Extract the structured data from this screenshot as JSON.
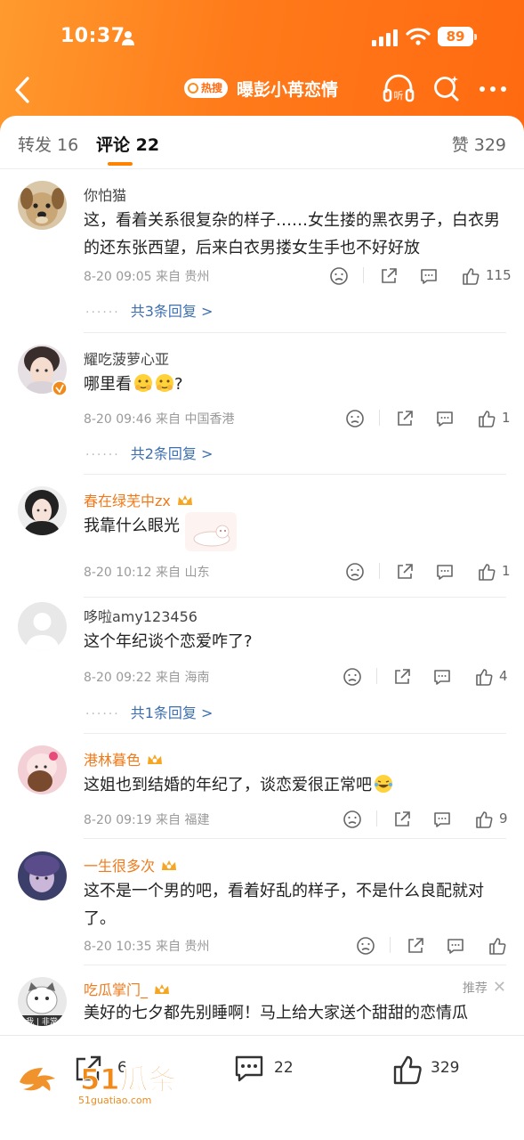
{
  "status": {
    "time": "10:37",
    "battery": "89"
  },
  "nav": {
    "hot_badge": "热搜",
    "title": "曝彭小苒恋情"
  },
  "tabs": {
    "repost": "转发 16",
    "comment": "评论 22",
    "likes": "赞 329"
  },
  "comments": [
    {
      "user": "你怕猫",
      "text": "这，看着关系很复杂的样子……女生搂的黑衣男子，白衣男的还东张西望，后来白衣男搂女生手也不好好放",
      "time": "8-20 09:05",
      "location": "来自 贵州",
      "likes": "115",
      "replies": "共3条回复 >"
    },
    {
      "user": "耀吃菠萝心亚",
      "text": "哪里看",
      "text_suffix": "?",
      "time": "8-20 09:46",
      "location": "来自 中国香港",
      "likes": "1",
      "replies": "共2条回复 >"
    },
    {
      "user": "春在绿芜中zx",
      "text": "我靠什么眼光",
      "time": "8-20 10:12",
      "location": "来自 山东",
      "likes": "1"
    },
    {
      "user": "哆啦amy123456",
      "text": "这个年纪谈个恋爱咋了?",
      "time": "8-20 09:22",
      "location": "来自 海南",
      "likes": "4",
      "replies": "共1条回复 >"
    },
    {
      "user": "港林暮色",
      "text": "这姐也到结婚的年纪了，谈恋爱很正常吧",
      "time": "8-20 09:19",
      "location": "来自 福建",
      "likes": "9"
    },
    {
      "user": "一生很多次",
      "text": "这不是一个男的吧，看着好乱的样子，不是什么良配就对了。",
      "time": "8-20 10:35",
      "location": "来自 贵州",
      "likes": ""
    },
    {
      "user": "吃瓜掌门_",
      "text": "美好的七夕都先别睡啊！马上给大家送个甜甜的恋情瓜",
      "recommend": "推荐",
      "avatar_caption": "我 | 非常"
    }
  ],
  "bottom": {
    "repost_count": "6",
    "comment_count": "22",
    "like_count": "329"
  },
  "watermark": {
    "brand": "51瓜条",
    "url": "51guatiao.com"
  },
  "colors": {
    "header": "#ff7a1a",
    "accent": "#ff8200",
    "link": "#3d6fb0"
  }
}
